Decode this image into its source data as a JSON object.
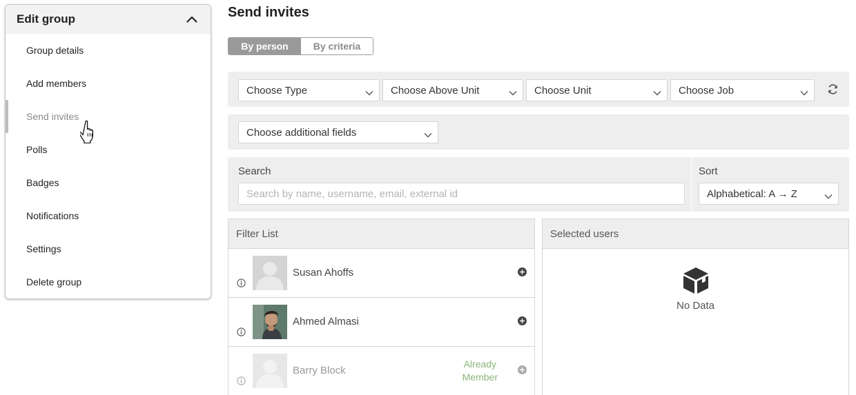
{
  "sidebar": {
    "title": "Edit group",
    "items": [
      {
        "label": "Group details"
      },
      {
        "label": "Add members"
      },
      {
        "label": "Send invites"
      },
      {
        "label": "Polls"
      },
      {
        "label": "Badges"
      },
      {
        "label": "Notifications"
      },
      {
        "label": "Settings"
      },
      {
        "label": "Delete group"
      }
    ],
    "active_item": "Send invites"
  },
  "main": {
    "title": "Send invites",
    "tabs": [
      {
        "label": "By person",
        "active": true
      },
      {
        "label": "By criteria",
        "active": false
      }
    ],
    "filters": {
      "type": "Choose Type",
      "above_unit": "Choose Above Unit",
      "unit": "Choose Unit",
      "job": "Choose Job",
      "additional_fields": "Choose additional fields"
    },
    "search": {
      "label": "Search",
      "placeholder": "Search by name, username, email, external id"
    },
    "sort": {
      "label": "Sort",
      "value": "Alphabetical: A → Z"
    },
    "filter_list": {
      "title": "Filter List",
      "users": [
        {
          "name": "Susan Ahoffs",
          "avatar": "placeholder",
          "status": ""
        },
        {
          "name": "Ahmed Almasi",
          "avatar": "photo",
          "status": ""
        },
        {
          "name": "Barry Block",
          "avatar": "placeholder",
          "status_line1": "Already",
          "status_line2": "Member"
        }
      ]
    },
    "selected_users": {
      "title": "Selected users",
      "empty_text": "No Data"
    }
  },
  "colors": {
    "tab_active_bg": "#9a9a9a",
    "panel_bg": "#eeeeee",
    "already_member": "#8bb57a"
  }
}
